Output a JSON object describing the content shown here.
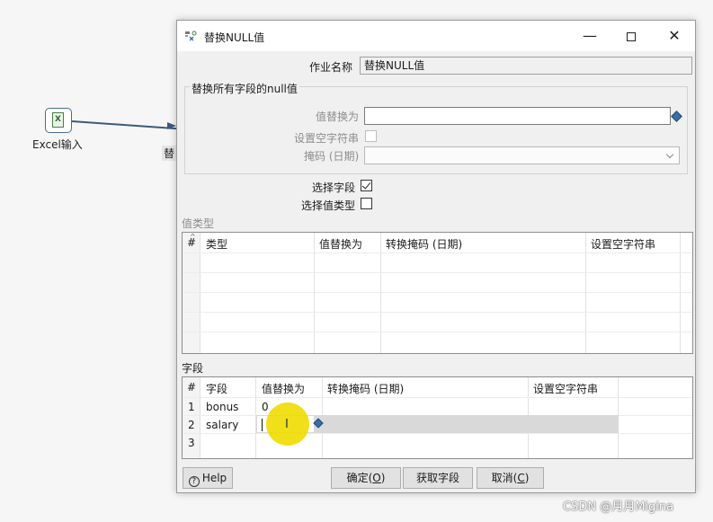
{
  "canvas": {
    "step_label": "Excel输入",
    "next_step_peek": "替"
  },
  "dialog": {
    "title": "替换NULL值",
    "job_name_label": "作业名称",
    "job_name_value": "替换NULL值",
    "group_title": "替换所有字段的null值",
    "replace_with_label": "值替换为",
    "replace_with_value": "",
    "set_empty_label": "设置空字符串",
    "mask_label": "掩码 (日期)",
    "mask_value": "",
    "select_fields_label": "选择字段",
    "select_fields_checked": true,
    "select_value_types_label": "选择值类型",
    "select_value_types_checked": false,
    "value_types_section": "值类型",
    "value_types_table": {
      "headers": [
        "#",
        "类型",
        "值替换为",
        "转换掩码 (日期)",
        "设置空字符串"
      ],
      "rows": []
    },
    "fields_section": "字段",
    "fields_table": {
      "headers": [
        "#",
        "字段",
        "值替换为",
        "转换掩码 (日期)",
        "设置空字符串"
      ],
      "rows": [
        {
          "num": "1",
          "field": "bonus",
          "replace": "0",
          "mask": "",
          "empty": ""
        },
        {
          "num": "2",
          "field": "salary",
          "replace": "",
          "mask": "",
          "empty": ""
        },
        {
          "num": "3",
          "field": "",
          "replace": "",
          "mask": "",
          "empty": ""
        }
      ]
    },
    "buttons": {
      "help": "Help",
      "ok": "确定",
      "ok_key": "O",
      "get_fields": "获取字段",
      "get_fields_key": "获",
      "cancel": "取消",
      "cancel_key": "C"
    },
    "window_controls": {
      "minimize": "—",
      "maximize": "",
      "close": "✕"
    }
  },
  "watermark": "CSDN @月月Migina",
  "colors": {
    "accent": "#3a6ea5",
    "cursor_highlight": "#f0dc00",
    "selected_row": "#d9d9d9"
  }
}
